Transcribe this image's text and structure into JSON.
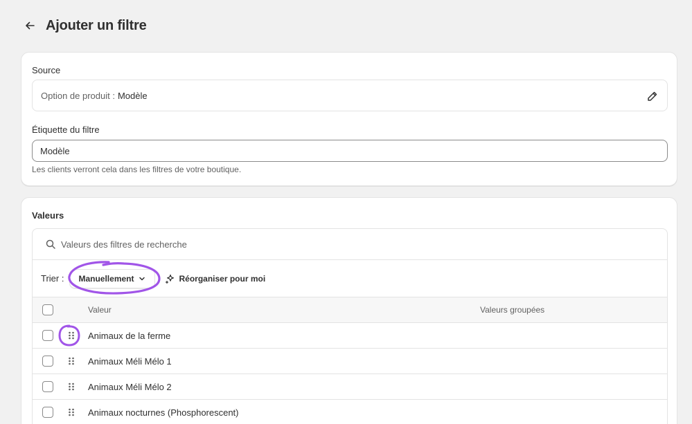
{
  "header": {
    "title": "Ajouter un filtre"
  },
  "source": {
    "label": "Source",
    "prefix": "Option de produit :",
    "value": "Modèle"
  },
  "filter_label": {
    "label": "Étiquette du filtre",
    "value": "Modèle",
    "help": "Les clients verront cela dans les filtres de votre boutique."
  },
  "values": {
    "title": "Valeurs",
    "search_placeholder": "Valeurs des filtres de recherche",
    "sort_label": "Trier :",
    "sort_value": "Manuellement",
    "reorganize_label": "Réorganiser pour moi",
    "columns": {
      "value": "Valeur",
      "grouped": "Valeurs groupées"
    },
    "rows": [
      {
        "value": "Animaux de la ferme"
      },
      {
        "value": "Animaux Méli Mélo 1"
      },
      {
        "value": "Animaux Méli Mélo 2"
      },
      {
        "value": "Animaux nocturnes (Phosphorescent)"
      }
    ]
  },
  "colors": {
    "annotation": "#a155e8",
    "border": "#e3e3e3",
    "text": "#303030"
  }
}
